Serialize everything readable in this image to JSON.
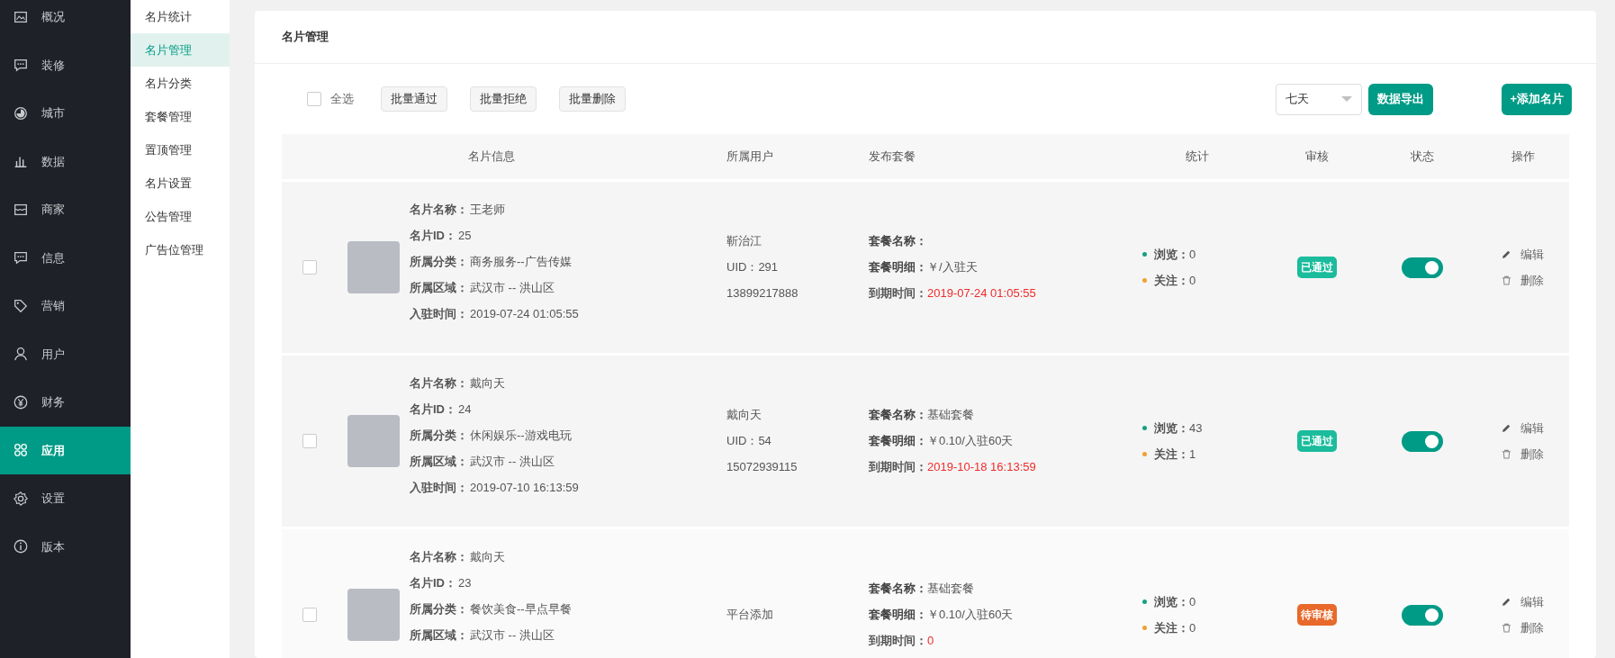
{
  "sidebar": {
    "items": [
      {
        "label": "概况",
        "selected": false
      },
      {
        "label": "装修",
        "selected": false
      },
      {
        "label": "城市",
        "selected": false
      },
      {
        "label": "数据",
        "selected": false
      },
      {
        "label": "商家",
        "selected": false
      },
      {
        "label": "信息",
        "selected": false
      },
      {
        "label": "营销",
        "selected": false
      },
      {
        "label": "用户",
        "selected": false
      },
      {
        "label": "财务",
        "selected": false
      },
      {
        "label": "应用",
        "selected": true
      },
      {
        "label": "设置",
        "selected": false
      },
      {
        "label": "版本",
        "selected": false
      }
    ]
  },
  "submenu": {
    "items": [
      {
        "label": "名片统计",
        "selected": false
      },
      {
        "label": "名片管理",
        "selected": true
      },
      {
        "label": "名片分类",
        "selected": false
      },
      {
        "label": "套餐管理",
        "selected": false
      },
      {
        "label": "置顶管理",
        "selected": false
      },
      {
        "label": "名片设置",
        "selected": false
      },
      {
        "label": "公告管理",
        "selected": false
      },
      {
        "label": "广告位管理",
        "selected": false
      }
    ]
  },
  "page_title": "名片管理",
  "toolbar": {
    "select_all": {
      "label": "全选",
      "checked": false
    },
    "batch_buttons": [
      "批量通过",
      "批量拒绝",
      "批量删除"
    ],
    "period_select": {
      "value": "七天"
    },
    "export_button": "数据导出",
    "add_button": "+添加名片"
  },
  "table": {
    "columns": [
      "名片信息",
      "所属用户",
      "发布套餐",
      "统计",
      "审核",
      "状态",
      "操作"
    ],
    "rows": [
      {
        "checked": false,
        "card_fields": [
          {
            "label": "名片名称：",
            "value": "王老师"
          },
          {
            "label": "名片ID：",
            "value": "25"
          },
          {
            "label": "所属分类：",
            "value": "商务服务--广告传媒"
          },
          {
            "label": "所属区域：",
            "value": "武汉市 -- 洪山区"
          },
          {
            "label": "入驻时间：",
            "value": "2019-07-24 01:05:55"
          }
        ],
        "user_lines": [
          "靳治江",
          "UID：291",
          "13899217888"
        ],
        "package_fields": [
          {
            "label": "套餐名称：",
            "kind": "text"
          },
          {
            "label": "套餐明细：",
            "value": "￥/入驻天",
            "kind": "text"
          },
          {
            "label": "到期时间：",
            "value": "2019-07-24 01:05:55",
            "kind": "deadline"
          }
        ],
        "stats": [
          {
            "label": "浏览：",
            "value": "0",
            "color": "#16a085"
          },
          {
            "label": "关注：",
            "value": "0",
            "color": "#f0a030"
          }
        ],
        "review": {
          "label": "已通过",
          "color": "#1abc9c"
        },
        "enabled": true,
        "actions": [
          {
            "kind": "edit",
            "label": "编辑"
          },
          {
            "kind": "delete",
            "label": "删除"
          }
        ]
      },
      {
        "checked": false,
        "card_fields": [
          {
            "label": "名片名称：",
            "value": "戴向天"
          },
          {
            "label": "名片ID：",
            "value": "24"
          },
          {
            "label": "所属分类：",
            "value": "休闲娱乐--游戏电玩"
          },
          {
            "label": "所属区域：",
            "value": "武汉市 -- 洪山区"
          },
          {
            "label": "入驻时间：",
            "value": "2019-07-10 16:13:59"
          }
        ],
        "user_lines": [
          "戴向天",
          "UID：54",
          "15072939115"
        ],
        "package_fields": [
          {
            "label": "套餐名称：",
            "value": "基础套餐",
            "kind": "text"
          },
          {
            "label": "套餐明细：",
            "value": "￥0.10/入驻60天",
            "kind": "text"
          },
          {
            "label": "到期时间：",
            "value": "2019-10-18 16:13:59",
            "kind": "deadline"
          }
        ],
        "stats": [
          {
            "label": "浏览：",
            "value": "43",
            "color": "#16a085"
          },
          {
            "label": "关注：",
            "value": "1",
            "color": "#f0a030"
          }
        ],
        "review": {
          "label": "已通过",
          "color": "#1abc9c"
        },
        "enabled": true,
        "actions": [
          {
            "kind": "edit",
            "label": "编辑"
          },
          {
            "kind": "delete",
            "label": "删除"
          }
        ]
      },
      {
        "checked": false,
        "card_fields": [
          {
            "label": "名片名称：",
            "value": "戴向天"
          },
          {
            "label": "名片ID：",
            "value": "23"
          },
          {
            "label": "所属分类：",
            "value": "餐饮美食--早点早餐"
          },
          {
            "label": "所属区域：",
            "value": "武汉市 -- 洪山区"
          }
        ],
        "user_lines": [
          "平台添加"
        ],
        "package_fields": [
          {
            "label": "套餐名称：",
            "value": "基础套餐",
            "kind": "text"
          },
          {
            "label": "套餐明细：",
            "value": "￥0.10/入驻60天",
            "kind": "text"
          },
          {
            "label": "到期时间：",
            "value": "0",
            "kind": "deadline"
          }
        ],
        "stats": [
          {
            "label": "浏览：",
            "value": "0",
            "color": "#16a085"
          },
          {
            "label": "关注：",
            "value": "0",
            "color": "#f0a030"
          }
        ],
        "review": {
          "label": "待审核",
          "color": "#e8692b"
        },
        "enabled": true,
        "actions": [
          {
            "kind": "edit",
            "label": "编辑"
          },
          {
            "kind": "delete",
            "label": "删除"
          }
        ]
      }
    ]
  }
}
